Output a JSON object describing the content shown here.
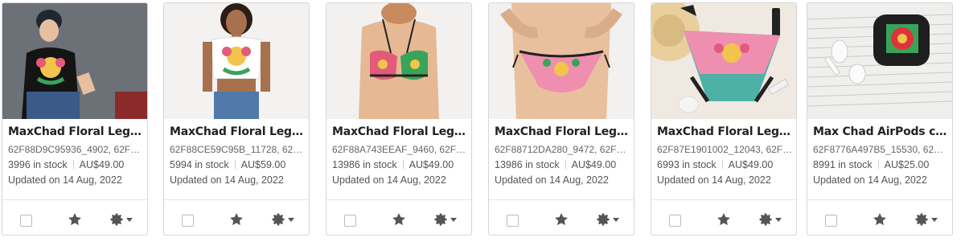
{
  "listings": [
    {
      "title": "MaxChad Floral Legend…",
      "sku": "62F88D9C95936_4902, 62F…",
      "stock": "3996 in stock",
      "price": "AU$49.00",
      "updated": "Updated on 14 Aug, 2022",
      "image": "woman-tshirt"
    },
    {
      "title": "MaxChad Floral Legend…",
      "sku": "62F88CE59C95B_11728, 62F…",
      "stock": "5994 in stock",
      "price": "AU$59.00",
      "updated": "Updated on 14 Aug, 2022",
      "image": "woman-crop-top"
    },
    {
      "title": "MaxChad Floral Legend…",
      "sku": "62F88A743EEAF_9460, 62F…",
      "stock": "13986 in stock",
      "price": "AU$49.00",
      "updated": "Updated on 14 Aug, 2022",
      "image": "bikini-top"
    },
    {
      "title": "MaxChad Floral Legend…",
      "sku": "62F88712DA280_9472, 62F8…",
      "stock": "13986 in stock",
      "price": "AU$49.00",
      "updated": "Updated on 14 Aug, 2022",
      "image": "bikini-bottom"
    },
    {
      "title": "MaxChad Floral Legend…",
      "sku": "62F87E1901002_12043, 62F…",
      "stock": "6993 in stock",
      "price": "AU$49.00",
      "updated": "Updated on 14 Aug, 2022",
      "image": "swim-bottom-flatlay"
    },
    {
      "title": "Max Chad AirPods case",
      "sku": "62F8776A497B5_15530, 62F…",
      "stock": "8991 in stock",
      "price": "AU$25.00",
      "updated": "Updated on 14 Aug, 2022",
      "image": "airpods-case"
    }
  ],
  "icons": {
    "checkbox": "checkbox-icon",
    "star": "star-icon",
    "gear": "gear-icon",
    "caret": "chevron-down-icon"
  },
  "colors": {
    "icon": "#555555",
    "border": "#d6d6d6",
    "text": "#222222",
    "muted": "#666666"
  }
}
